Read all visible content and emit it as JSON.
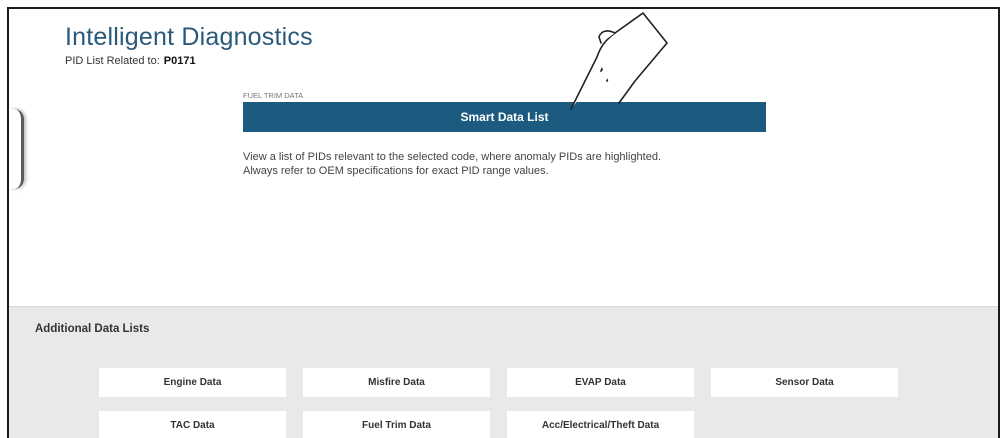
{
  "header": {
    "title": "Intelligent Diagnostics",
    "subtitle_prefix": "PID List Related to:",
    "code": "P0171"
  },
  "main": {
    "section_label": "FUEL TRIM DATA",
    "primary_button": "Smart Data List",
    "description_line1": "View a list of PIDs relevant to the selected code, where anomaly PIDs are highlighted.",
    "description_line2": "Always refer to OEM specifications for exact PID range values."
  },
  "additional": {
    "title": "Additional Data Lists",
    "buttons": [
      "Engine Data",
      "Misfire Data",
      "EVAP Data",
      "Sensor Data",
      "TAC Data",
      "Fuel Trim Data",
      "Acc/Electrical/Theft Data"
    ]
  },
  "icons": {
    "pointer": "pointing-hand-icon"
  },
  "colors": {
    "title": "#2a5a7a",
    "primary_button": "#1d5a80",
    "additional_bg": "#e9e9e9"
  }
}
